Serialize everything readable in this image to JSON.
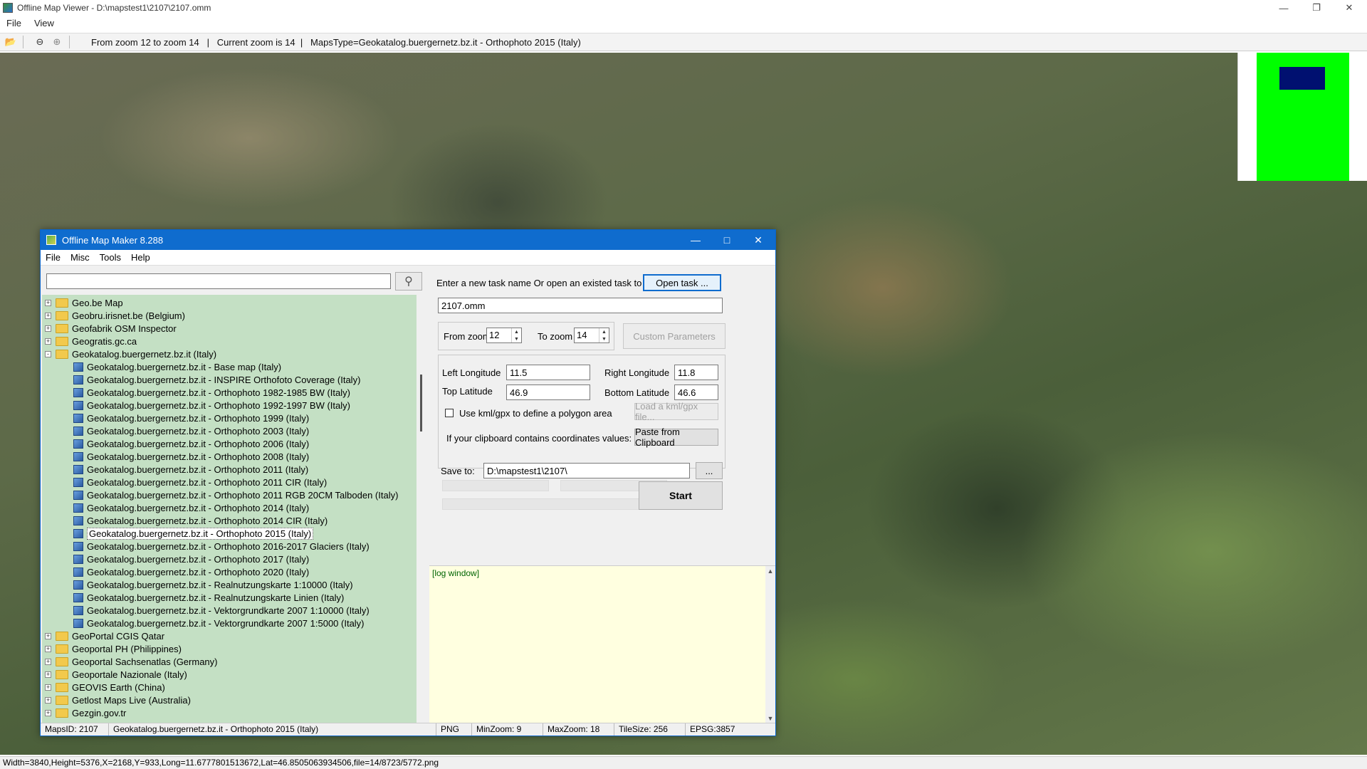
{
  "outer": {
    "title": "Offline Map Viewer - D:\\mapstest1\\2107\\2107.omm",
    "menu": [
      "File",
      "View"
    ],
    "toolbar_info": "From zoom 12 to zoom 14   |   Current zoom is 14  |   MapsType=Geokatalog.buergernetz.bz.it - Orthophoto 2015 (Italy)",
    "status": "Width=3840,Height=5376,X=2168,Y=933,Long=11.6777801513672,Lat=46.8505063934506,file=14/8723/5772.png",
    "minimap_colors": {
      "view": "#00ff00",
      "rect": "#001070"
    }
  },
  "dialog": {
    "title": "Offline Map Maker 8.288",
    "menu": [
      "File",
      "Misc",
      "Tools",
      "Help"
    ],
    "search_value": "",
    "tree": [
      {
        "label": "Geo.be Map",
        "type": "folder",
        "expand": "+"
      },
      {
        "label": "Geobru.irisnet.be (Belgium)",
        "type": "folder",
        "expand": "+"
      },
      {
        "label": "Geofabrik OSM Inspector",
        "type": "folder",
        "expand": "+"
      },
      {
        "label": "Geogratis.gc.ca",
        "type": "folder",
        "expand": "+"
      },
      {
        "label": "Geokatalog.buergernetz.bz.it (Italy)",
        "type": "folder",
        "expand": "-"
      },
      {
        "label": "Geokatalog.buergernetz.bz.it - Base map (Italy)",
        "type": "map"
      },
      {
        "label": "Geokatalog.buergernetz.bz.it - INSPIRE Orthofoto Coverage (Italy)",
        "type": "map"
      },
      {
        "label": "Geokatalog.buergernetz.bz.it - Orthophoto 1982-1985 BW (Italy)",
        "type": "map"
      },
      {
        "label": "Geokatalog.buergernetz.bz.it - Orthophoto 1992-1997 BW (Italy)",
        "type": "map"
      },
      {
        "label": "Geokatalog.buergernetz.bz.it - Orthophoto 1999 (Italy)",
        "type": "map"
      },
      {
        "label": "Geokatalog.buergernetz.bz.it - Orthophoto 2003 (Italy)",
        "type": "map"
      },
      {
        "label": "Geokatalog.buergernetz.bz.it - Orthophoto 2006 (Italy)",
        "type": "map"
      },
      {
        "label": "Geokatalog.buergernetz.bz.it - Orthophoto 2008 (Italy)",
        "type": "map"
      },
      {
        "label": "Geokatalog.buergernetz.bz.it - Orthophoto 2011 (Italy)",
        "type": "map"
      },
      {
        "label": "Geokatalog.buergernetz.bz.it - Orthophoto 2011 CIR (Italy)",
        "type": "map"
      },
      {
        "label": "Geokatalog.buergernetz.bz.it - Orthophoto 2011 RGB 20CM Talboden (Italy)",
        "type": "map"
      },
      {
        "label": "Geokatalog.buergernetz.bz.it - Orthophoto 2014 (Italy)",
        "type": "map"
      },
      {
        "label": "Geokatalog.buergernetz.bz.it - Orthophoto 2014 CIR (Italy)",
        "type": "map"
      },
      {
        "label": "Geokatalog.buergernetz.bz.it - Orthophoto 2015 (Italy)",
        "type": "map",
        "selected": true
      },
      {
        "label": "Geokatalog.buergernetz.bz.it - Orthophoto 2016-2017 Glaciers (Italy)",
        "type": "map"
      },
      {
        "label": "Geokatalog.buergernetz.bz.it - Orthophoto 2017 (Italy)",
        "type": "map"
      },
      {
        "label": "Geokatalog.buergernetz.bz.it - Orthophoto 2020 (Italy)",
        "type": "map"
      },
      {
        "label": "Geokatalog.buergernetz.bz.it - Realnutzungskarte 1:10000 (Italy)",
        "type": "map"
      },
      {
        "label": "Geokatalog.buergernetz.bz.it - Realnutzungskarte Linien (Italy)",
        "type": "map"
      },
      {
        "label": "Geokatalog.buergernetz.bz.it - Vektorgrundkarte 2007 1:10000 (Italy)",
        "type": "map"
      },
      {
        "label": "Geokatalog.buergernetz.bz.it - Vektorgrundkarte 2007 1:5000 (Italy)",
        "type": "map"
      },
      {
        "label": "GeoPortal CGIS Qatar",
        "type": "folder",
        "expand": "+"
      },
      {
        "label": "Geoportal PH (Philippines)",
        "type": "folder",
        "expand": "+"
      },
      {
        "label": "Geoportal Sachsenatlas (Germany)",
        "type": "folder",
        "expand": "+"
      },
      {
        "label": "Geoportale Nazionale (Italy)",
        "type": "folder",
        "expand": "+"
      },
      {
        "label": "GEOVIS Earth (China)",
        "type": "folder",
        "expand": "+"
      },
      {
        "label": "Getlost Maps Live (Australia)",
        "type": "folder",
        "expand": "+"
      },
      {
        "label": "Gezgin.gov.tr",
        "type": "folder",
        "expand": "+"
      }
    ],
    "task_prompt": "Enter a new task name Or open an existed task to continue:",
    "open_task_label": "Open task ...",
    "task_name": "2107.omm",
    "from_zoom_label": "From zoom",
    "from_zoom": "12",
    "to_zoom_label": "To zoom",
    "to_zoom": "14",
    "custom_params_label": "Custom Parameters",
    "left_lon_label": "Left Longitude",
    "left_lon": "11.5",
    "right_lon_label": "Right Longitude",
    "right_lon": "11.8",
    "top_lat_label": "Top Latitude",
    "top_lat": "46.9",
    "bottom_lat_label": "Bottom Latitude",
    "bottom_lat": "46.6",
    "kml_label": "Use kml/gpx to define a polygon area",
    "load_kml_label": "Load a kml/gpx file...",
    "clipboard_prompt": "If your clipboard contains coordinates values:",
    "paste_label": "Paste from Clipboard",
    "save_to_label": "Save to:",
    "save_to": "D:\\mapstest1\\2107\\",
    "browse_label": "...",
    "start_label": "Start",
    "log_text": "[log window]",
    "status": {
      "maps_id": "MapsID: 2107",
      "map_name": "Geokatalog.buergernetz.bz.it - Orthophoto 2015 (Italy)",
      "format": "PNG",
      "min_zoom": "MinZoom: 9",
      "max_zoom": "MaxZoom: 18",
      "tile_size": "TileSize: 256",
      "epsg": "EPSG:3857"
    }
  }
}
